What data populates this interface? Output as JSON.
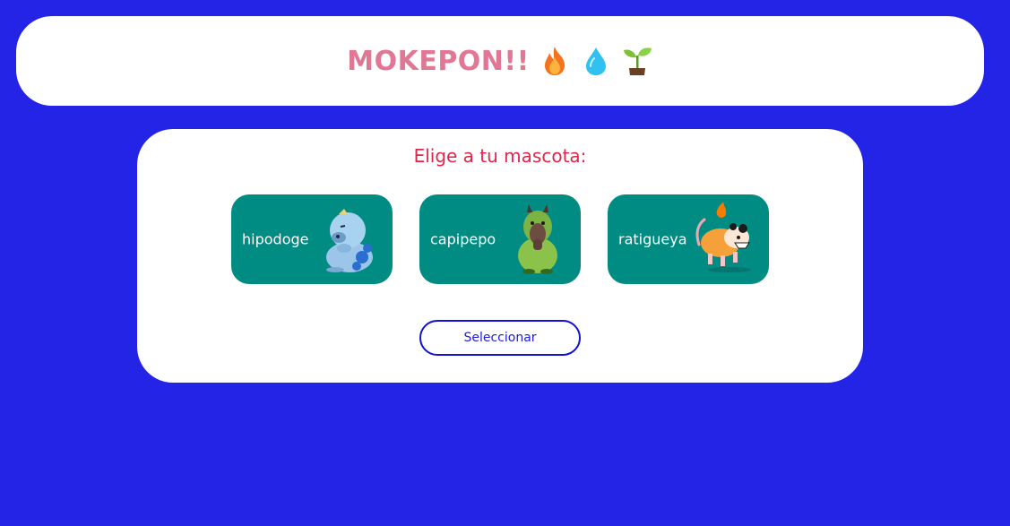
{
  "header": {
    "title": "MOKEPON!!",
    "emojis": [
      "fire-icon",
      "water-drop-icon",
      "seedling-icon"
    ]
  },
  "selection": {
    "prompt": "Elige a tu mascota:",
    "pets": [
      {
        "label": "hipodoge",
        "icon": "hipodoge-image"
      },
      {
        "label": "capipepo",
        "icon": "capipepo-image"
      },
      {
        "label": "ratigueya",
        "icon": "ratigueya-image"
      }
    ],
    "select_label": "Seleccionar"
  },
  "colors": {
    "background": "#2424e6",
    "title": "#e07795",
    "prompt": "#e2264b",
    "pet_card": "#008b83",
    "button_border": "#1212d4"
  }
}
